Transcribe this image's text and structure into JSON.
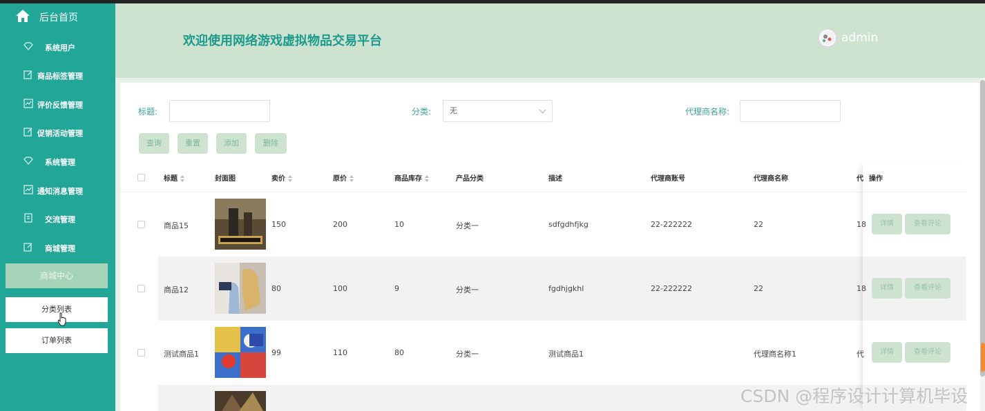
{
  "sidebar": {
    "home_label": "后台首页",
    "items": [
      {
        "label": "系统用户",
        "icon": "diamond-icon"
      },
      {
        "label": "商品标签管理",
        "icon": "edit-icon"
      },
      {
        "label": "评价反馈管理",
        "icon": "chart-icon"
      },
      {
        "label": "促销活动管理",
        "icon": "edit-icon"
      },
      {
        "label": "系统管理",
        "icon": "diamond-icon"
      },
      {
        "label": "通知消息管理",
        "icon": "chart-icon"
      },
      {
        "label": "交流管理",
        "icon": "doc-icon"
      },
      {
        "label": "商城管理",
        "icon": "edit-icon"
      }
    ],
    "active_group": "商城中心",
    "sub_items": [
      "分类列表",
      "订单列表"
    ]
  },
  "header": {
    "title": "欢迎使用网络游戏虚拟物品交易平台",
    "username": "admin"
  },
  "search": {
    "title_label": "标题:",
    "title_value": "",
    "category_label": "分类:",
    "category_value": "无",
    "agent_label": "代理商名称:",
    "agent_value": ""
  },
  "buttons": {
    "query": "查询",
    "reset": "重置",
    "add": "添加",
    "delete": "删除"
  },
  "table": {
    "columns": [
      "标题",
      "封面图",
      "卖价",
      "原价",
      "商品库存",
      "产品分类",
      "描述",
      "代理商账号",
      "代理商名称",
      "代",
      "操作"
    ],
    "rows": [
      {
        "title": "商品15",
        "price": "150",
        "orig_price": "200",
        "stock": "10",
        "category": "分类一",
        "desc": "sdfgdhfjkg",
        "agent_account": "22-222222",
        "agent_name": "22",
        "trunc": "18"
      },
      {
        "title": "商品12",
        "price": "80",
        "orig_price": "100",
        "stock": "9",
        "category": "分类一",
        "desc": "fgdhjgkhl",
        "agent_account": "22-222222",
        "agent_name": "22",
        "trunc": "18"
      },
      {
        "title": "测试商品1",
        "price": "99",
        "orig_price": "110",
        "stock": "80",
        "category": "分类一",
        "desc": "测试商品1",
        "agent_account": "",
        "agent_name": "代理商名称1",
        "trunc": "代"
      }
    ],
    "op_detail": "详情",
    "op_comments": "查看评论"
  },
  "watermark": "CSDN @程序设计计算机毕设",
  "colors": {
    "sidebar": "#22a698",
    "header": "#cde3d0",
    "title": "#1e9a8c",
    "button": "#cde3d0"
  }
}
